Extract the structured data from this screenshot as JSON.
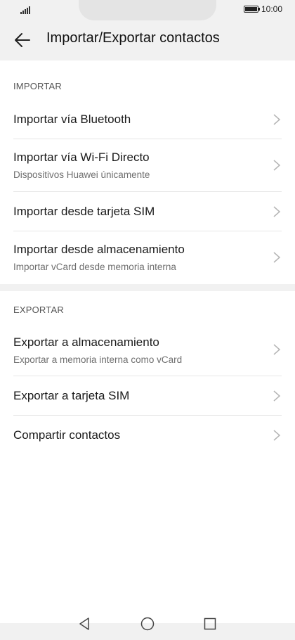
{
  "status": {
    "time": "10:00",
    "signal_icon": "signal-icon",
    "battery_icon": "battery-icon"
  },
  "header": {
    "title": "Importar/Exportar contactos",
    "back_icon": "arrow-left-icon"
  },
  "import": {
    "label": "IMPORTAR",
    "items": [
      {
        "title": "Importar vía Bluetooth",
        "subtitle": ""
      },
      {
        "title": "Importar vía Wi-Fi Directo",
        "subtitle": "Dispositivos Huawei únicamente"
      },
      {
        "title": "Importar desde tarjeta SIM",
        "subtitle": ""
      },
      {
        "title": "Importar desde almacenamiento",
        "subtitle": "Importar vCard desde memoria interna"
      }
    ]
  },
  "export": {
    "label": "EXPORTAR",
    "items": [
      {
        "title": "Exportar a almacenamiento",
        "subtitle": "Exportar a memoria interna como vCard"
      },
      {
        "title": "Exportar a tarjeta SIM",
        "subtitle": ""
      },
      {
        "title": "Compartir contactos",
        "subtitle": ""
      }
    ]
  },
  "navbar": {
    "back_icon": "triangle-back-icon",
    "home_icon": "circle-home-icon",
    "recents_icon": "square-recents-icon"
  },
  "colors": {
    "background": "#f1f1f1",
    "card": "#ffffff",
    "text": "#1a1a1a",
    "secondary_text": "#6f6f6f"
  }
}
